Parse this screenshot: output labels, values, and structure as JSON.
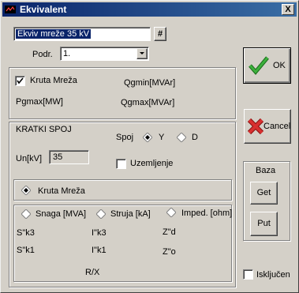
{
  "window": {
    "title": "Ekvivalent",
    "close_label": "X"
  },
  "name_field": {
    "value": "Ekviv mreže 35 kV",
    "hash_label": "#"
  },
  "podr": {
    "label": "Podr.",
    "value": "1."
  },
  "kruta_mreza_top": {
    "label": "Kruta Mreža",
    "checked": true
  },
  "labels": {
    "qgmin": "Qgmin[MVAr]",
    "pgmax": "Pgmax[MW]",
    "qgmax": "Qgmax[MVAr]"
  },
  "kratki_spoj": {
    "title": "KRATKI SPOJ",
    "spoj_label": "Spoj",
    "spoj_y": "Y",
    "spoj_d": "D",
    "un_label": "Un[kV]",
    "un_value": "35",
    "uzemljenje": "Uzemljenje",
    "kruta_mreza": "Kruta Mreža",
    "snaga": "Snaga [MVA]",
    "struja": "Struja [kA]",
    "imped": "Imped. [ohm]",
    "sk3": "S\"k3",
    "ik3": "I\"k3",
    "zd": "Z\"d",
    "sk1": "S\"k1",
    "ik1": "I\"k1",
    "zo": "Z\"o",
    "rx": "R/X"
  },
  "buttons": {
    "ok": "OK",
    "cancel": "Cancel",
    "baza_title": "Baza",
    "get": "Get",
    "put": "Put"
  },
  "iskljucen": {
    "label": "Isključen",
    "checked": false
  },
  "colors": {
    "title_start": "#0a246a",
    "title_end": "#3a6ea5",
    "ok_check": "#2a8a2a",
    "cancel_x": "#c02020"
  }
}
